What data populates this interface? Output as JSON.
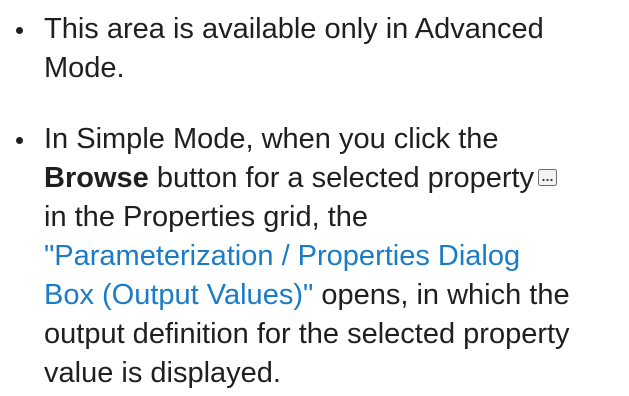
{
  "bullets": [
    {
      "lines": [
        "This area is available only in Advanced",
        "Mode."
      ]
    },
    {
      "line1": "In Simple Mode, when you click the",
      "browse_label": "Browse",
      "line2_after_bold": " button for a selected property",
      "browse_icon": "ellipsis-button-icon",
      "line3": "in the Properties grid, the",
      "link_lines": [
        "\"Parameterization / Properties Dialog",
        "Box (Output Values)\""
      ],
      "line5_after_link": " opens, in which the",
      "line6": "output definition for the selected property",
      "line7": "value is displayed."
    }
  ],
  "colors": {
    "text": "#1f1f1f",
    "link": "#1a7bc7"
  }
}
